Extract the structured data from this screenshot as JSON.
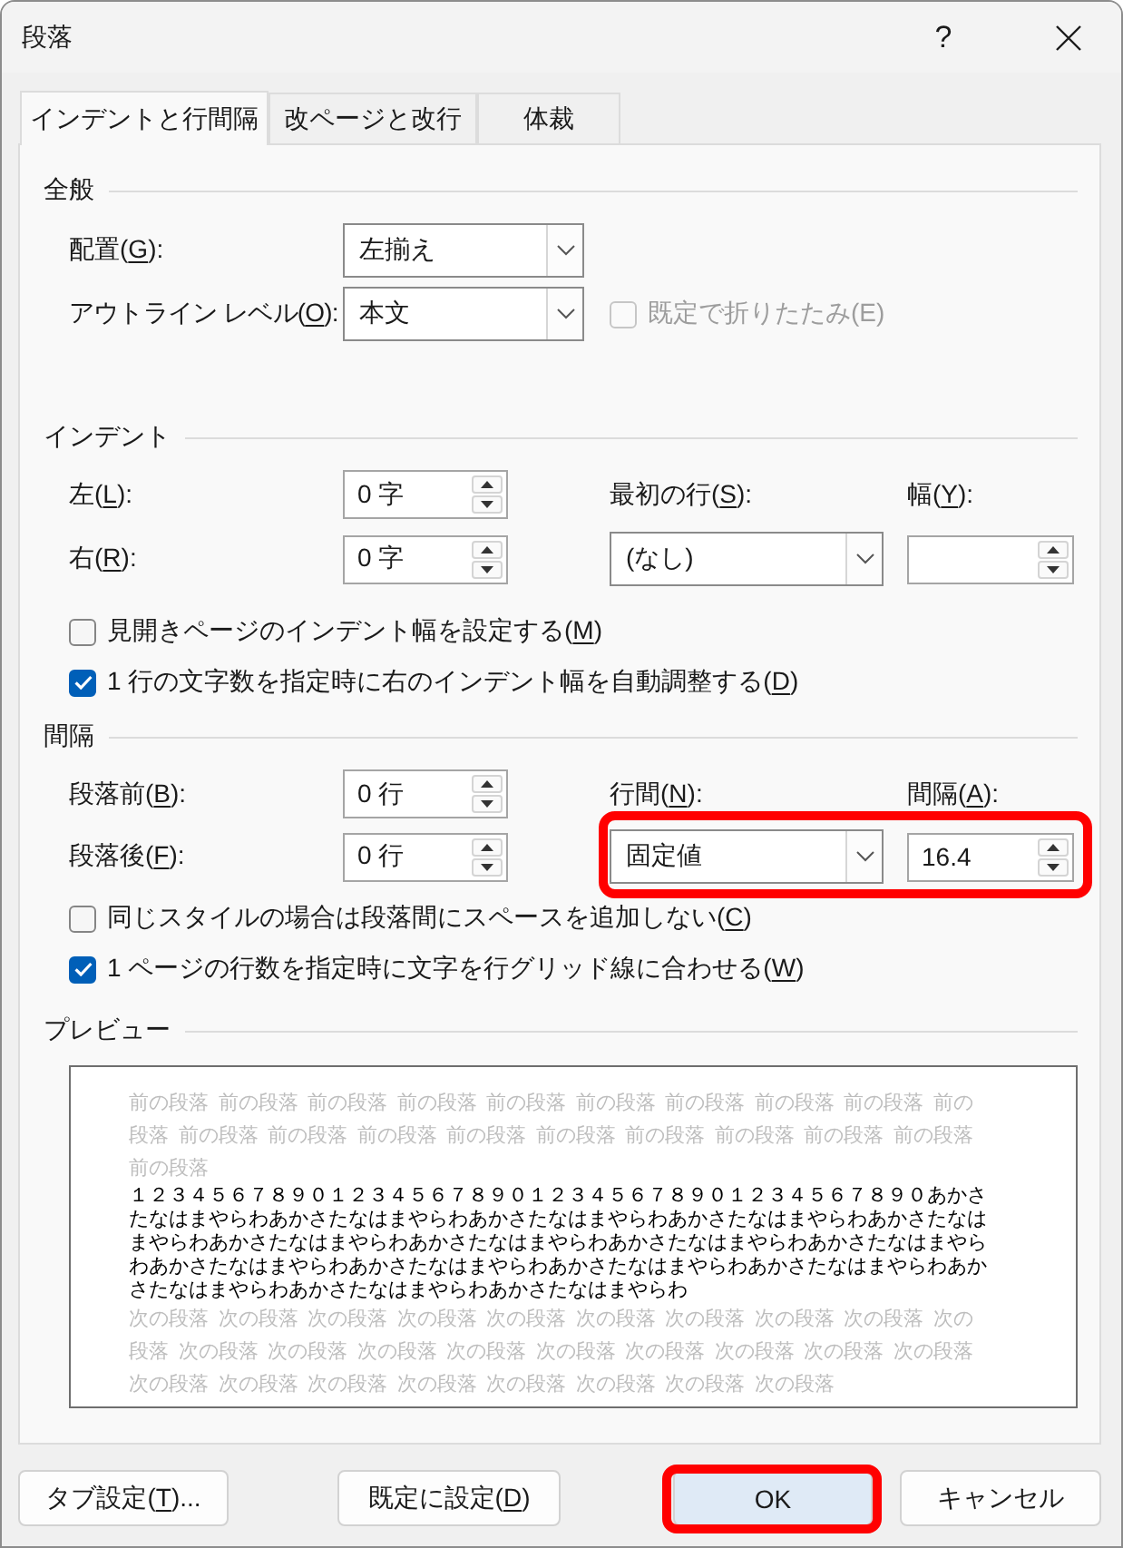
{
  "window": {
    "title": "段落",
    "help_label": "?"
  },
  "tabs": [
    {
      "label": "インデントと行間隔",
      "selected": true
    },
    {
      "label": "改ページと改行",
      "selected": false
    },
    {
      "label": "体裁",
      "selected": false
    }
  ],
  "general": {
    "heading": "全般",
    "alignment": {
      "label": "配置(",
      "access_key": "G",
      "label_after": "):",
      "value": "左揃え"
    },
    "outline_level": {
      "label": "アウトライン レベル(",
      "access_key": "O",
      "label_after": "):",
      "value": "本文"
    },
    "collapse_by_default": {
      "label": "既定で折りたたみ(E)",
      "checked": false,
      "disabled": true
    }
  },
  "indentation": {
    "heading": "インデント",
    "left": {
      "label": "左(",
      "access_key": "L",
      "label_after": "):",
      "value": "0 字"
    },
    "right": {
      "label": "右(",
      "access_key": "R",
      "label_after": "):",
      "value": "0 字"
    },
    "special": {
      "label": "最初の行(",
      "access_key": "S",
      "label_after": "):",
      "value": "(なし)"
    },
    "by": {
      "label": "幅(",
      "access_key": "Y",
      "label_after": "):"
    },
    "checkboxes": [
      {
        "label": "見開きページのインデント幅を設定する(",
        "access_key": "M",
        "label_after": ")",
        "checked": false,
        "disabled": false
      },
      {
        "label": "1 行の文字数を指定時に右のインデント幅を自動調整する(",
        "access_key": "D",
        "label_after": ")",
        "checked": true,
        "disabled": false
      }
    ]
  },
  "spacing": {
    "heading": "間隔",
    "before": {
      "label": "段落前(",
      "access_key": "B",
      "label_after": "):",
      "value": "0 行"
    },
    "after": {
      "label": "段落後(",
      "access_key": "F",
      "label_after": "):",
      "value": "0 行"
    },
    "line_spacing": {
      "label": "行間(",
      "access_key": "N",
      "label_after": "):",
      "value": "固定値"
    },
    "at": {
      "label": "間隔(",
      "access_key": "A",
      "label_after": "):",
      "value": "16.4"
    },
    "line_spacing_highlighted": true,
    "checkboxes": [
      {
        "label": "同じスタイルの場合は段落間にスペースを追加しない(",
        "access_key": "C",
        "label_after": ")",
        "checked": false,
        "disabled": false
      },
      {
        "label": "1 ページの行数を指定時に文字を行グリッド線に合わせる(",
        "access_key": "W",
        "label_after": ")",
        "checked": true,
        "disabled": false
      }
    ]
  },
  "preview": {
    "heading": "プレビュー",
    "paragraphs": [
      {
        "kind": "previous",
        "lines": [
          "前の段落 前の段落 前の段落 前の段落 前の段落 前の段落 前の段落 前の段落 前の段落 前の",
          "段落 前の段落 前の段落 前の段落 前の段落 前の段落 前の段落 前の段落 前の段落 前の段落",
          "前の段落"
        ]
      },
      {
        "kind": "sample",
        "lines": [
          "１２３４５６７８９０１２３４５６７８９０１２３４５６７８９０１２３４５６７８９０あかさ",
          "たなはまやらわあかさたなはまやらわあかさたなはまやらわあかさたなはまやらわあかさたなは",
          "まやらわあかさたなはまやらわあかさたなはまやらわあかさたなはまやらわあかさたなはまやら",
          "わあかさたなはまやらわあかさたなはまやらわあかさたなはまやらわあかさたなはまやらわあか",
          "さたなはまやらわあかさたなはまやらわあかさたなはまやらわ"
        ]
      },
      {
        "kind": "next",
        "lines": [
          "次の段落 次の段落 次の段落 次の段落 次の段落 次の段落 次の段落 次の段落 次の段落 次の",
          "段落 次の段落 次の段落 次の段落 次の段落 次の段落 次の段落 次の段落 次の段落 次の段落",
          "次の段落 次の段落 次の段落 次の段落 次の段落 次の段落 次の段落 次の段落"
        ]
      }
    ]
  },
  "buttons": [
    {
      "label": "タブ設定(",
      "access_key": "T",
      "label_after": ")...",
      "default": false,
      "highlighted": false
    },
    {
      "label": "既定に設定(",
      "access_key": "D",
      "label_after": ")",
      "default": false,
      "highlighted": false
    },
    {
      "label": "OK",
      "default": true,
      "highlighted": true
    },
    {
      "label": "キャンセル",
      "default": false,
      "highlighted": false
    }
  ]
}
